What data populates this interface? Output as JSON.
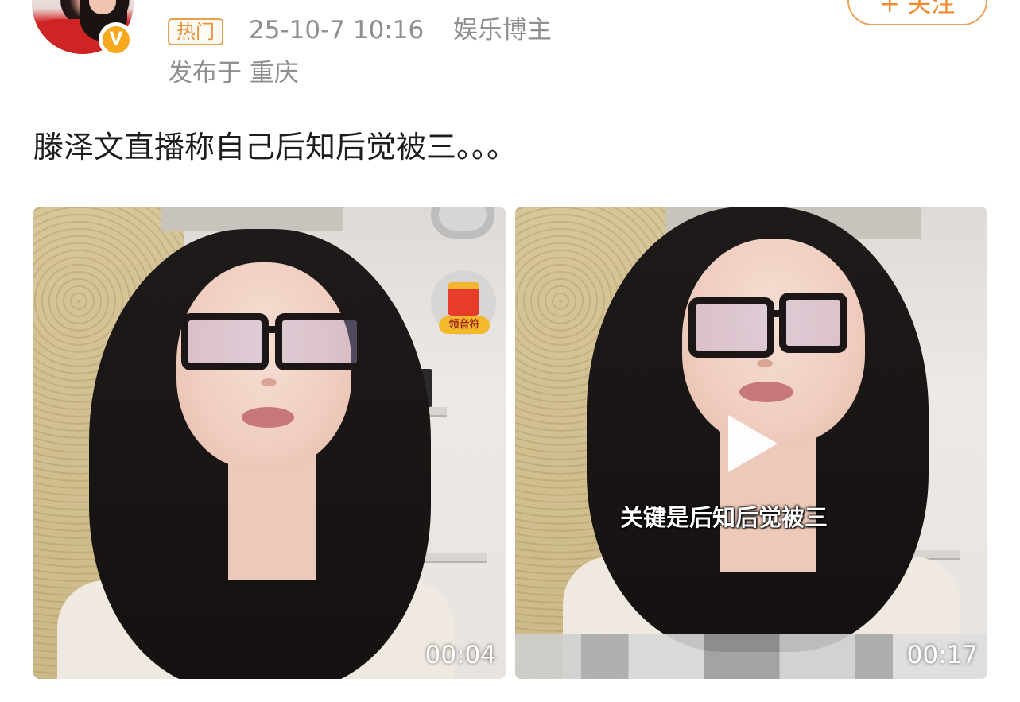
{
  "post": {
    "hot_badge": "热门",
    "timestamp": "25-10-7 10:16",
    "author_role": "娱乐博主",
    "location": "发布于 重庆",
    "follow_label": "+ 关注",
    "verified_badge": "V",
    "text": "滕泽文直播称自己后知后觉被三。。。"
  },
  "videos": [
    {
      "duration": "00:04",
      "gift_badge_label": "领音符"
    },
    {
      "duration": "00:17",
      "subtitle": "关键是后知后觉被三"
    }
  ],
  "icons": {
    "verified": "verified-v-icon",
    "play": "play-icon",
    "gift": "gift-box-icon"
  },
  "colors": {
    "accent_orange": "#f08a2e",
    "meta_gray": "#8f8f8f",
    "text_dark": "#1d1d1d",
    "verified_yellow": "#f7a81c"
  }
}
